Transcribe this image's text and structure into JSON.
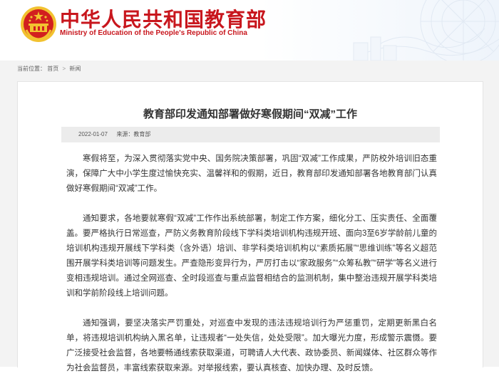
{
  "header": {
    "site_name_cn": "中华人民共和国教育部",
    "site_name_en": "Ministry of Education of the People's Republic of China",
    "emblem_icon": "national-emblem-icon",
    "brand_color": "#c8161d"
  },
  "breadcrumb": {
    "label": "当前位置：",
    "items": [
      "首页",
      "新闻"
    ]
  },
  "article": {
    "title": "教育部印发通知部署做好寒假期间“双减”工作",
    "date": "2022-01-07",
    "source_label": "来源：",
    "source": "教育部",
    "paragraphs": [
      "寒假将至，为深入贯彻落实党中央、国务院决策部署，巩固“双减”工作成果，严防校外培训旧态重演，保障广大中小学生度过愉快充实、温馨祥和的假期，近日，教育部印发通知部署各地教育部门认真做好寒假期间“双减”工作。",
      "通知要求，各地要就寒假“双减”工作作出系统部署，制定工作方案，细化分工、压实责任、全面覆盖。要严格执行日常巡查，严防义务教育阶段线下学科类培训机构违规开班、面向3至6岁学龄前儿童的培训机构违规开展线下学科类（含外语）培训、非学科类培训机构以“素质拓展”“思维训练”等名义超范围开展学科类培训等问题发生。严查隐形变异行为，严厉打击以“家政服务”“众筹私教”“研学”等名义进行变相违规培训。通过全网巡查、全时段巡查与重点监督相结合的监测机制，集中整治违规开展学科类培训和学前阶段线上培训问题。",
      "通知强调，要坚决落实严罚重处，对巡查中发现的违法违规培训行为严惩重罚，定期更新黑白名单，将违规培训机构纳入黑名单，让违规者“一处失信，处处受限”。加大曝光力度，形成警示震慑。要广泛接受社会监督，各地要畅通线索获取渠道，可聘请人大代表、政协委员、新闻媒体、社区群众等作为社会监督员，丰富线索获取来源。对举报线索，要认真核查、加快办理、及时反馈。"
    ]
  }
}
